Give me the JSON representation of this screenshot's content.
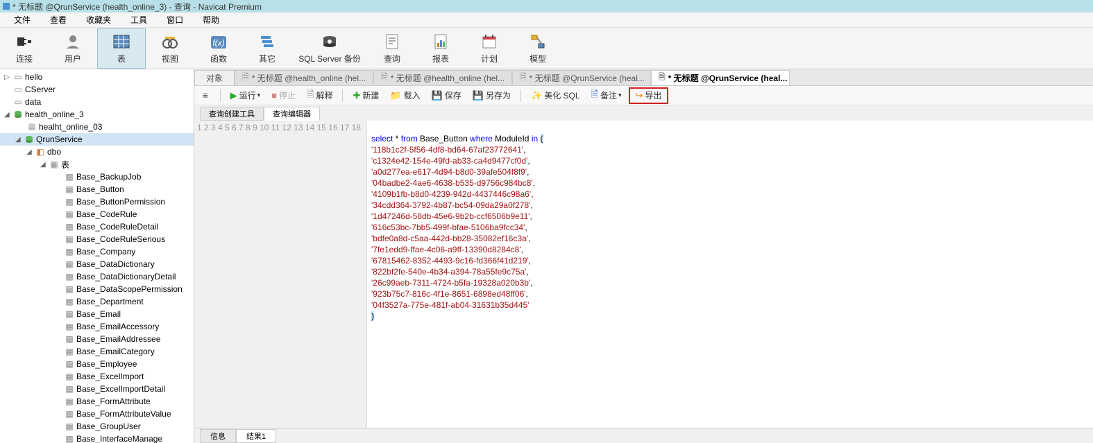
{
  "window": {
    "title": "* 无标题 @QrunService (health_online_3) - 查询 - Navicat Premium"
  },
  "menubar": [
    "文件",
    "查看",
    "收藏夹",
    "工具",
    "窗口",
    "帮助"
  ],
  "maintoolbar": [
    {
      "id": "connect",
      "label": "连接",
      "icon": "plug"
    },
    {
      "id": "user",
      "label": "用户",
      "icon": "user"
    },
    {
      "id": "table",
      "label": "表",
      "icon": "table",
      "active": true
    },
    {
      "id": "view",
      "label": "视图",
      "icon": "view"
    },
    {
      "id": "func",
      "label": "函数",
      "icon": "fx"
    },
    {
      "id": "other",
      "label": "其它",
      "icon": "stack"
    },
    {
      "id": "sqlbackup",
      "label": "SQL Server 备份",
      "icon": "backup"
    },
    {
      "id": "query",
      "label": "查询",
      "icon": "query"
    },
    {
      "id": "report",
      "label": "报表",
      "icon": "report"
    },
    {
      "id": "schedule",
      "label": "计划",
      "icon": "calendar"
    },
    {
      "id": "model",
      "label": "模型",
      "icon": "model"
    }
  ],
  "tree": {
    "top": [
      {
        "label": "hello",
        "icon": "conn",
        "arrow": "▷"
      },
      {
        "label": "CServer",
        "icon": "blank",
        "arrow": ""
      },
      {
        "label": "data",
        "icon": "blank",
        "arrow": ""
      }
    ],
    "db1": {
      "label": "health_online_3",
      "arrow": "◢",
      "child": {
        "label": "healht_online_03"
      }
    },
    "db2": {
      "label": "QrunService",
      "arrow": "◢",
      "selected": true
    },
    "dbo": {
      "label": "dbo",
      "arrow": "◢"
    },
    "tables_header": "表",
    "tables": [
      "Base_BackupJob",
      "Base_Button",
      "Base_ButtonPermission",
      "Base_CodeRule",
      "Base_CodeRuleDetail",
      "Base_CodeRuleSerious",
      "Base_Company",
      "Base_DataDictionary",
      "Base_DataDictionaryDetail",
      "Base_DataScopePermission",
      "Base_Department",
      "Base_Email",
      "Base_EmailAccessory",
      "Base_EmailAddressee",
      "Base_EmailCategory",
      "Base_Employee",
      "Base_ExcelImport",
      "Base_ExcelImportDetail",
      "Base_FormAttribute",
      "Base_FormAttributeValue",
      "Base_GroupUser",
      "Base_InterfaceManage"
    ]
  },
  "tabs": [
    {
      "label": "对象",
      "first": true
    },
    {
      "label": "* 无标题 @health_online (hel..."
    },
    {
      "label": "* 无标题 @health_online (hel..."
    },
    {
      "label": "* 无标题 @QrunService (heal..."
    },
    {
      "label": "* 无标题 @QrunService (heal...",
      "active": true
    }
  ],
  "querytb": {
    "run": "运行",
    "stop": "停止",
    "explain": "解释",
    "new": "新建",
    "load": "载入",
    "save": "保存",
    "saveas": "另存为",
    "beautify": "美化 SQL",
    "comment": "备注",
    "export": "导出"
  },
  "subtabs": [
    {
      "label": "查询创建工具"
    },
    {
      "label": "查询编辑器",
      "active": true
    }
  ],
  "sql": {
    "header_kw1": "select",
    "header_kw2": "from",
    "header_tbl": "Base_Button",
    "header_kw3": "where",
    "header_col": "ModuleId",
    "header_kw4": "in",
    "lines": [
      "'118b1c2f-5f56-4df8-bd64-67af23772641',",
      "'c1324e42-154e-49fd-ab33-ca4d9477cf0d',",
      "'a0d277ea-e617-4d94-b8d0-39afe504f8f9',",
      "'04badbe2-4ae6-4638-b535-d9756c984bc8',",
      "'4109b1fb-b8d0-4239-942d-4437446c98a6',",
      "'34cdd364-3792-4b87-bc54-09da29a0f278',",
      "'1d47246d-58db-45e6-9b2b-ccf6506b9e11',",
      "'616c53bc-7bb5-499f-bfae-5106ba9fcc34',",
      "'bdfe0a8d-c5aa-442d-bb28-35082ef16c3a',",
      "'7fe1edd9-ffae-4c06-a9ff-13390d8284c8',",
      "'67815462-8352-4493-9c16-fd366f41d219',",
      "'822bf2fe-540e-4b34-a394-78a55fe9c75a',",
      "'26c99aeb-7311-4724-b5fa-19328a020b3b',",
      "'923b75c7-816c-4f1e-8651-6898ed48ff06',",
      "'04f3527a-775e-481f-ab04-31631b35d445'"
    ]
  },
  "bottomtabs": [
    {
      "label": "信息"
    },
    {
      "label": "结果1",
      "active": true
    }
  ]
}
